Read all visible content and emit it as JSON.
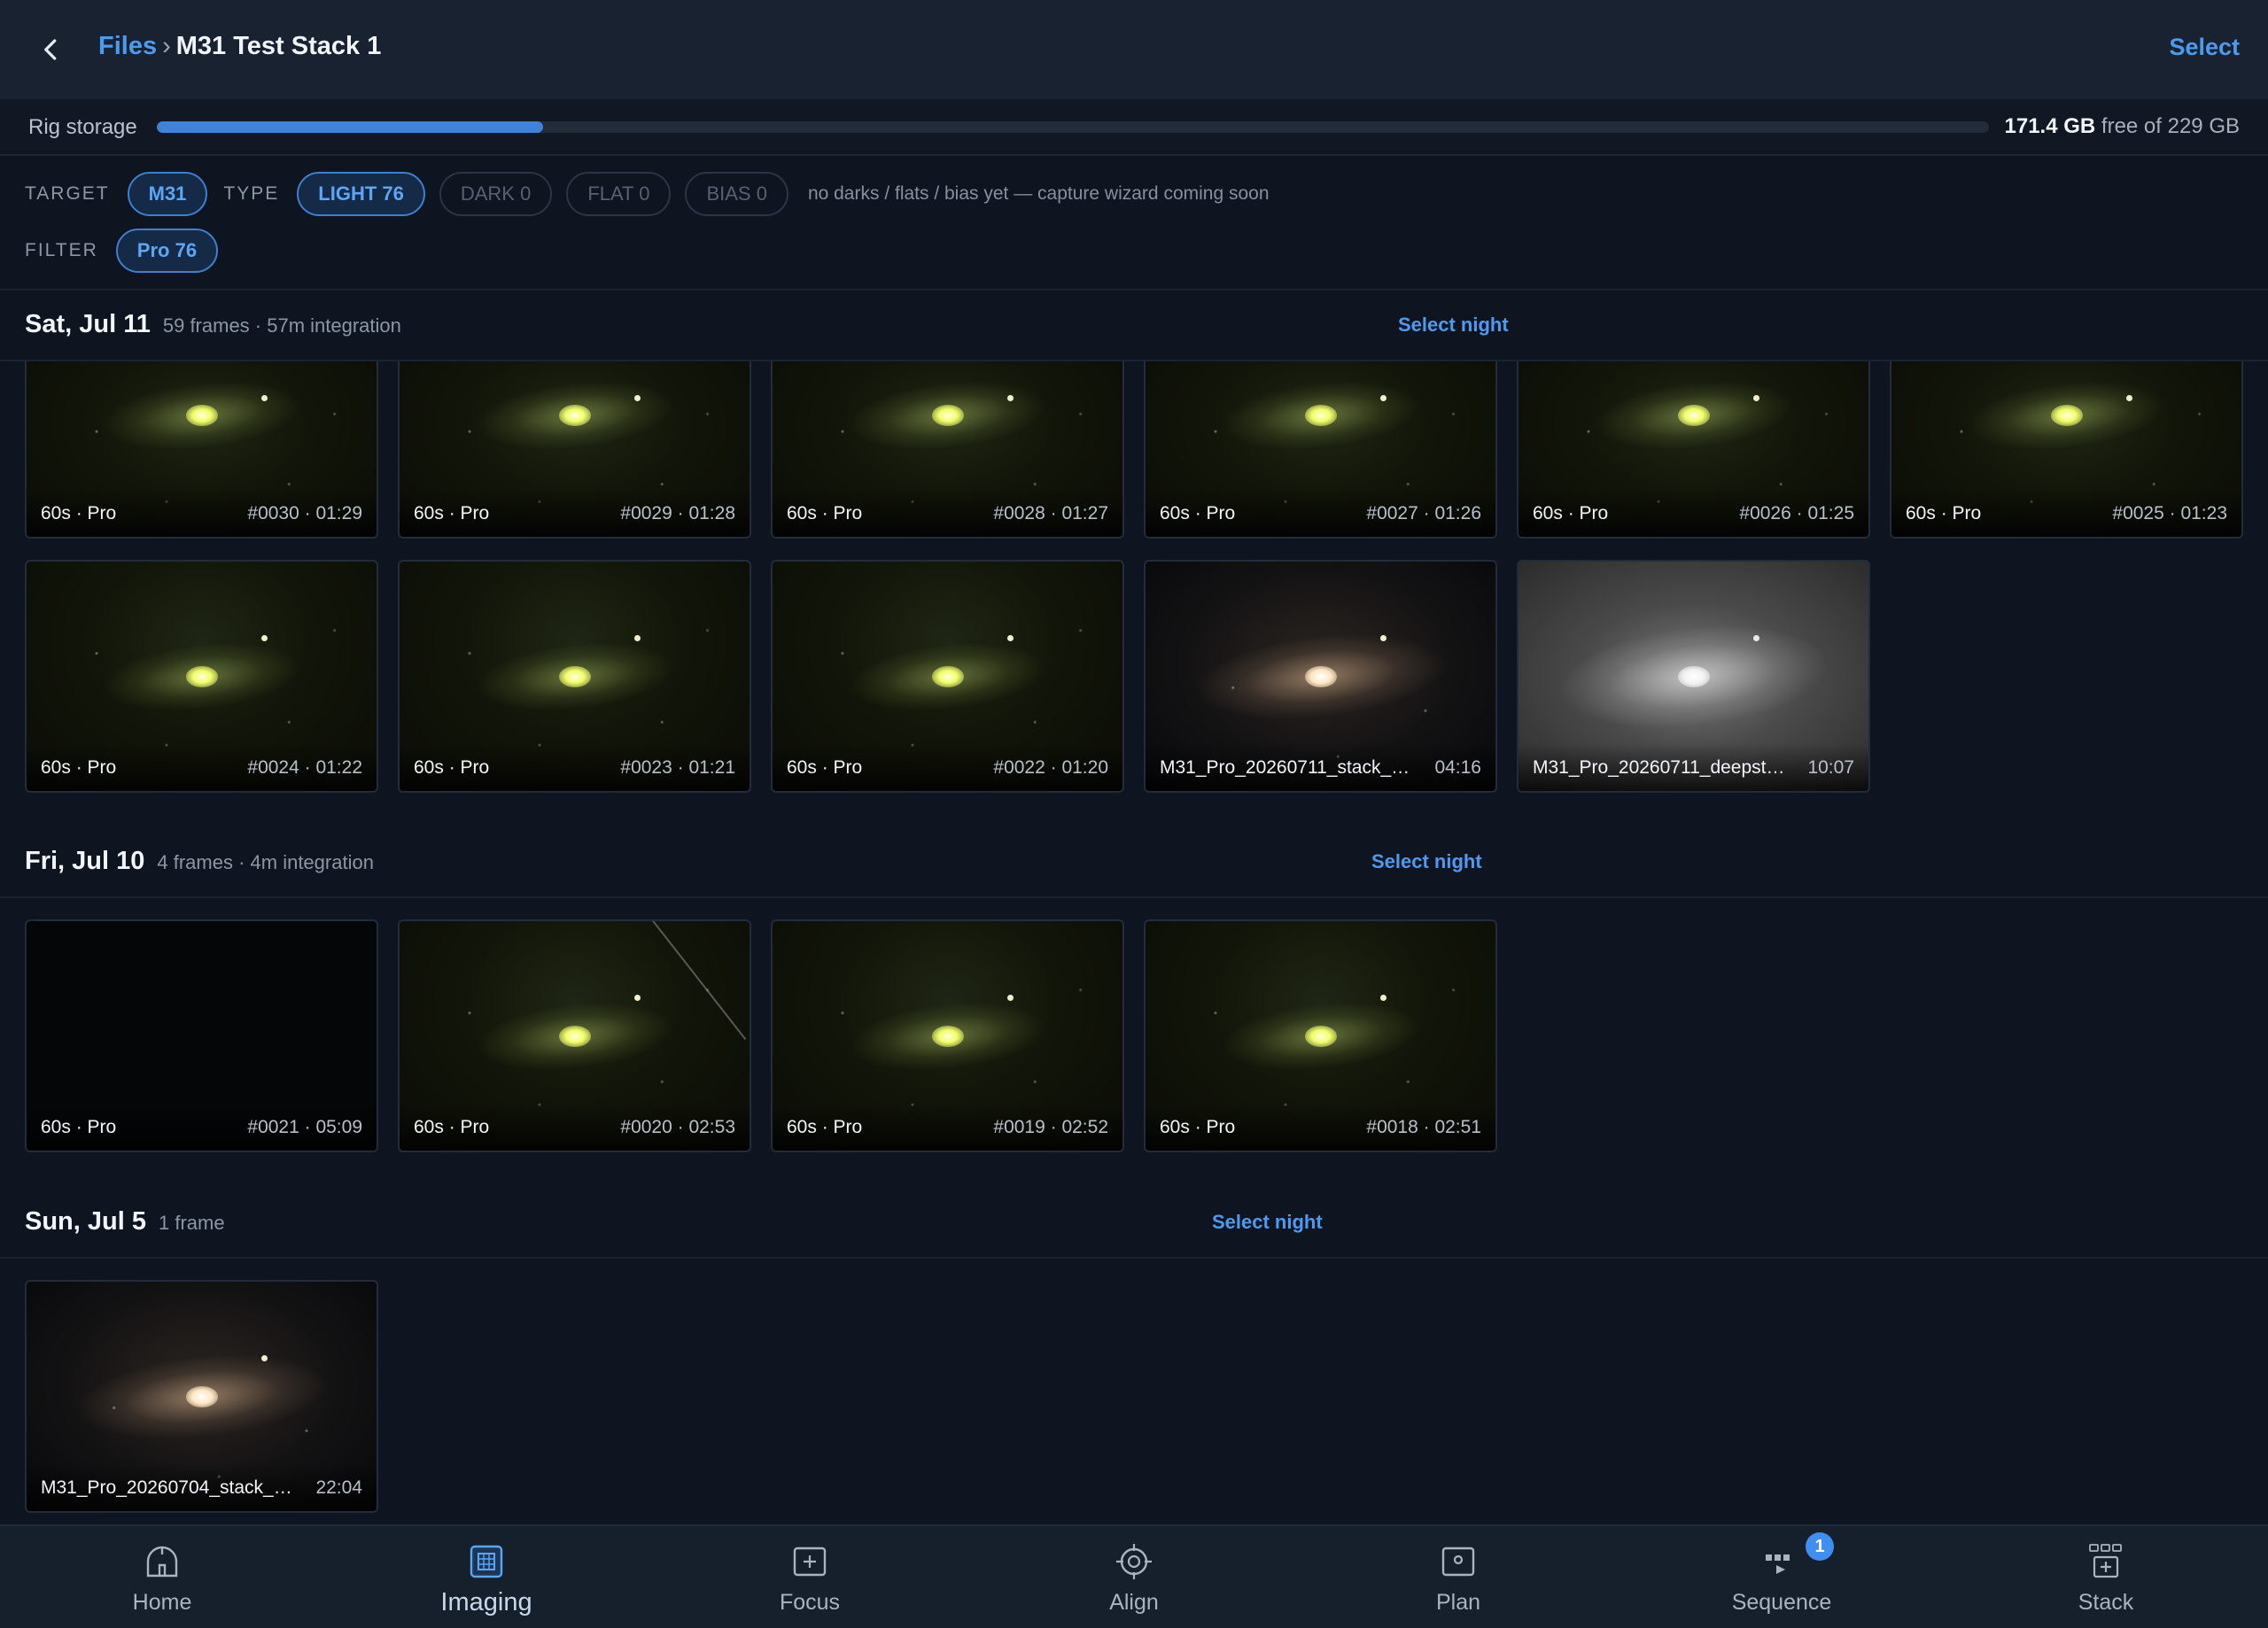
{
  "header": {
    "crumb_parent": "Files",
    "crumb_sep": "›",
    "crumb_current": "M31 Test Stack 1",
    "select_label": "Select"
  },
  "storage": {
    "label": "Rig storage",
    "used_fraction": 0.211,
    "free_value": "171.4 GB",
    "free_suffix": "free of 229 GB"
  },
  "filters": {
    "target_label": "TARGET",
    "target_chip": "M31",
    "type_label": "TYPE",
    "type_chips": [
      "LIGHT 76",
      "DARK 0",
      "FLAT 0",
      "BIAS 0"
    ],
    "note": "no darks / flats / bias yet — capture wizard coming soon",
    "filter_label": "FILTER",
    "filter_chip": "Pro 76"
  },
  "sections": [
    {
      "title": "Sat, Jul 11",
      "meta": "59 frames · 57m integration",
      "select_label": "Select night",
      "frames": [
        {
          "left": "60s · Pro",
          "right": "#0030 · 01:29",
          "style": "green"
        },
        {
          "left": "60s · Pro",
          "right": "#0029 · 01:28",
          "style": "green"
        },
        {
          "left": "60s · Pro",
          "right": "#0028 · 01:27",
          "style": "green"
        },
        {
          "left": "60s · Pro",
          "right": "#0027 · 01:26",
          "style": "green"
        },
        {
          "left": "60s · Pro",
          "right": "#0026 · 01:25",
          "style": "green"
        },
        {
          "left": "60s · Pro",
          "right": "#0025 · 01:23",
          "style": "green"
        },
        {
          "left": "60s · Pro",
          "right": "#0024 · 01:22",
          "style": "green"
        },
        {
          "left": "60s · Pro",
          "right": "#0023 · 01:21",
          "style": "green"
        },
        {
          "left": "60s · Pro",
          "right": "#0022 · 01:20",
          "style": "green"
        },
        {
          "left": "M31_Pro_20260711_stack_00...",
          "right": "04:16",
          "style": "color"
        },
        {
          "left": "M31_Pro_20260711_deepstac...",
          "right": "10:07",
          "style": "gray"
        }
      ]
    },
    {
      "title": "Fri, Jul 10",
      "meta": "4 frames · 4m integration",
      "select_label": "Select night",
      "frames": [
        {
          "left": "60s · Pro",
          "right": "#0021 · 05:09",
          "style": "dark"
        },
        {
          "left": "60s · Pro",
          "right": "#0020 · 02:53",
          "style": "green"
        },
        {
          "left": "60s · Pro",
          "right": "#0019 · 02:52",
          "style": "green"
        },
        {
          "left": "60s · Pro",
          "right": "#0018 · 02:51",
          "style": "green"
        }
      ]
    },
    {
      "title": "Sun, Jul 5",
      "meta": "1 frame",
      "select_label": "Select night",
      "frames": [
        {
          "left": "M31_Pro_20260704_stack_00...",
          "right": "22:04",
          "style": "color"
        }
      ]
    }
  ],
  "nav": {
    "items": [
      {
        "label": "Home",
        "icon": "observatory-icon"
      },
      {
        "label": "Imaging",
        "icon": "imaging-icon",
        "active": true
      },
      {
        "label": "Focus",
        "icon": "focus-icon"
      },
      {
        "label": "Align",
        "icon": "align-icon"
      },
      {
        "label": "Plan",
        "icon": "plan-icon"
      },
      {
        "label": "Sequence",
        "icon": "sequence-icon",
        "badge": "1"
      },
      {
        "label": "Stack",
        "icon": "stack-icon"
      }
    ]
  },
  "colors": {
    "accent": "#4d9bf0",
    "background": "#0e1420",
    "header": "#182231"
  }
}
